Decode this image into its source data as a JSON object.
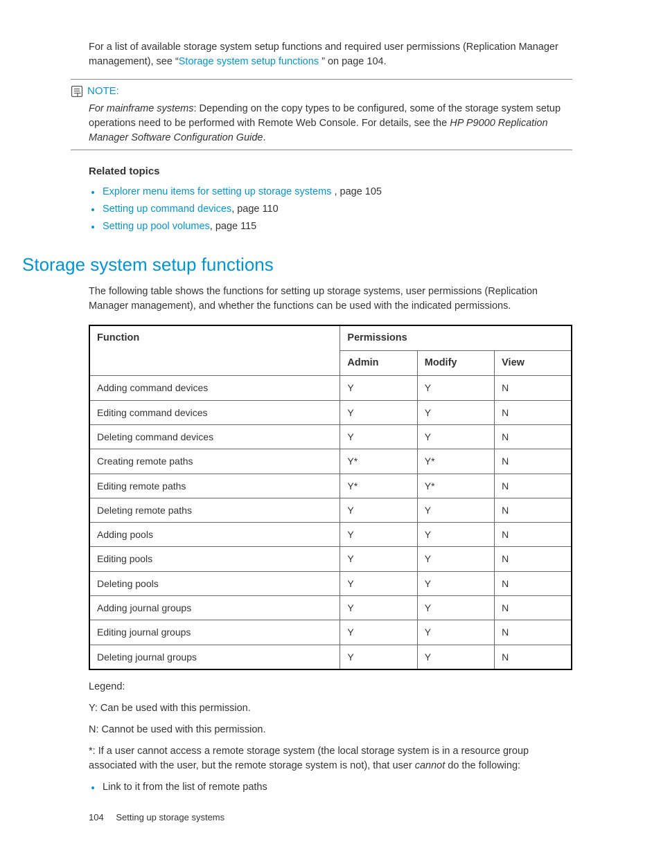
{
  "intro": {
    "prefix": "For a list of available storage system setup functions and required user permissions (Replication Manager management), see “",
    "link": "Storage system setup functions ",
    "suffix": "” on page 104."
  },
  "note": {
    "label": "NOTE:",
    "lead_italic": "For mainframe systems",
    "body_before": ": Depending on the copy types to be configured, some of the storage system setup operations need to be performed with Remote Web Console. For details, see the ",
    "doc_title": "HP P9000 Replication Manager Software Configuration Guide",
    "body_after": "."
  },
  "related": {
    "heading": "Related topics",
    "items": [
      {
        "link": "Explorer menu items for setting up storage systems ",
        "tail": ", page 105"
      },
      {
        "link": "Setting up command devices",
        "tail": ", page 110"
      },
      {
        "link": "Setting up pool volumes",
        "tail": ", page 115"
      }
    ]
  },
  "section": {
    "title": "Storage system setup functions",
    "para": "The following table shows the functions for setting up storage systems, user permissions (Replication Manager management), and whether the functions can be used with the indicated permissions."
  },
  "table": {
    "headers": {
      "function": "Function",
      "permissions": "Permissions",
      "admin": "Admin",
      "modify": "Modify",
      "view": "View"
    },
    "rows": [
      {
        "f": "Adding command devices",
        "a": "Y",
        "m": "Y",
        "v": "N"
      },
      {
        "f": "Editing command devices",
        "a": "Y",
        "m": "Y",
        "v": "N"
      },
      {
        "f": "Deleting command devices",
        "a": "Y",
        "m": "Y",
        "v": "N"
      },
      {
        "f": "Creating remote paths",
        "a": "Y*",
        "m": "Y*",
        "v": "N"
      },
      {
        "f": "Editing remote paths",
        "a": "Y*",
        "m": "Y*",
        "v": "N"
      },
      {
        "f": "Deleting remote paths",
        "a": "Y",
        "m": "Y",
        "v": "N"
      },
      {
        "f": "Adding pools",
        "a": "Y",
        "m": "Y",
        "v": "N"
      },
      {
        "f": "Editing pools",
        "a": "Y",
        "m": "Y",
        "v": "N"
      },
      {
        "f": "Deleting pools",
        "a": "Y",
        "m": "Y",
        "v": "N"
      },
      {
        "f": "Adding journal groups",
        "a": "Y",
        "m": "Y",
        "v": "N"
      },
      {
        "f": "Editing journal groups",
        "a": "Y",
        "m": "Y",
        "v": "N"
      },
      {
        "f": "Deleting journal groups",
        "a": "Y",
        "m": "Y",
        "v": "N"
      }
    ]
  },
  "legend": {
    "l0": "Legend:",
    "l1": "Y: Can be used with this permission.",
    "l2": "N: Cannot be used with this permission.",
    "l3_pre": "*: If a user cannot access a remote storage system (the local storage system is in a resource group associated with the user, but the remote storage system is not), that user ",
    "l3_em": "cannot",
    "l3_post": " do the following:",
    "bullet": "Link to it from the list of remote paths"
  },
  "footer": {
    "page": "104",
    "title": "Setting up storage systems"
  }
}
